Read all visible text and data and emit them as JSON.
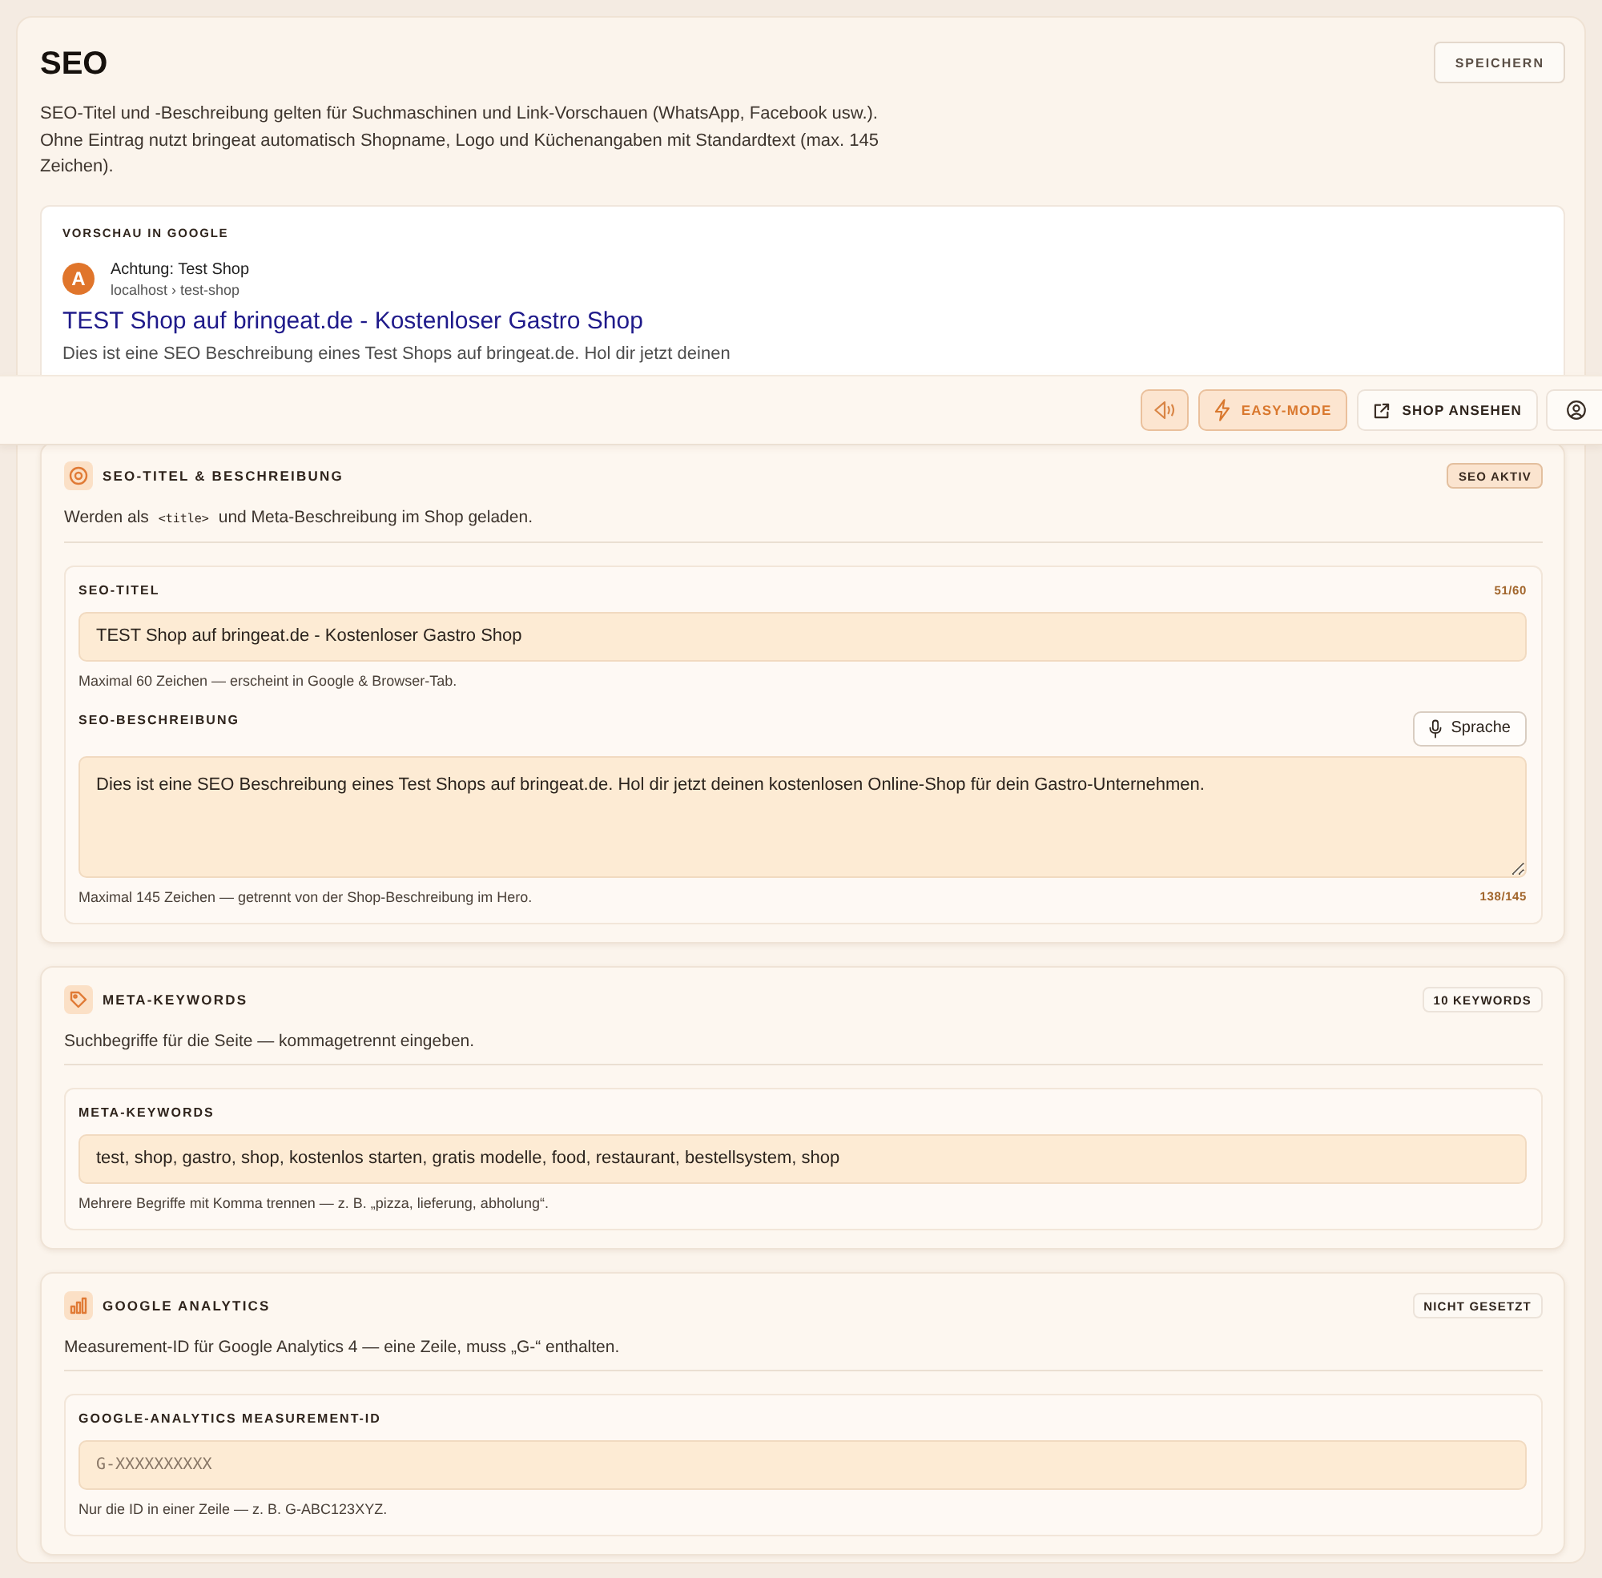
{
  "page": {
    "title": "SEO",
    "save_button": "SPEICHERN",
    "intro": "SEO-Titel und -Beschreibung gelten für Suchmaschinen und Link-Vorschauen (WhatsApp, Facebook usw.). Ohne Eintrag nutzt bringeat automatisch Shopname, Logo und Küchenangaben mit Standardtext (max. 145 Zeichen)."
  },
  "preview": {
    "heading": "VORSCHAU IN GOOGLE",
    "avatar_letter": "A",
    "site_name": "Achtung: Test Shop",
    "url": "localhost › test-shop",
    "title": "TEST Shop auf bringeat.de - Kostenloser Gastro Shop",
    "description": "Dies ist eine SEO Beschreibung eines Test Shops auf bringeat.de. Hol dir jetzt deinen"
  },
  "toolbar": {
    "sound_button": {
      "on": true
    },
    "easy_mode_button": {
      "label": "EASY-MODE",
      "on": true
    },
    "shop_button": {
      "label": "SHOP ANSEHEN"
    }
  },
  "sections": [
    {
      "kind": "seo",
      "title": "SEO-TITEL & BESCHREIBUNG",
      "badge": {
        "label": "SEO AKTIV",
        "active": true
      },
      "description": [
        {
          "kind": "text",
          "text": "Werden als "
        },
        {
          "kind": "code",
          "text": "<title>"
        },
        {
          "kind": "text",
          "text": " und Meta-Beschreibung im Shop geladen."
        }
      ],
      "fields": [
        {
          "kind": "input",
          "label": "SEO-TITEL",
          "counter": "51/60",
          "value": "TEST Shop auf bringeat.de - Kostenloser Gastro Shop",
          "hint": "Maximal 60 Zeichen — erscheint in Google & Browser-Tab."
        },
        {
          "kind": "textarea",
          "label": "SEO-BESCHREIBUNG",
          "voice_button": "Sprache",
          "value": "Dies ist eine SEO Beschreibung eines Test Shops auf bringeat.de. Hol dir jetzt deinen kostenlosen Online-Shop für dein Gastro-Unternehmen.",
          "hint": "Maximal 145 Zeichen — getrennt von der Shop-Beschreibung im Hero.",
          "counter": "138/145"
        }
      ]
    },
    {
      "kind": "keywords",
      "title": "META-KEYWORDS",
      "badge": {
        "label": "10 KEYWORDS",
        "active": false
      },
      "description": [
        {
          "kind": "text",
          "text": "Suchbegriffe für die Seite — kommagetrennt eingeben."
        }
      ],
      "fields": [
        {
          "kind": "input",
          "label": "META-KEYWORDS",
          "value": "test, shop, gastro, shop, kostenlos starten, gratis modelle, food, restaurant, bestellsystem, shop",
          "hint": "Mehrere Begriffe mit Komma trennen — z. B. „pizza, lieferung, abholung“."
        }
      ]
    },
    {
      "kind": "analytics",
      "title": "GOOGLE ANALYTICS",
      "badge": {
        "label": "NICHT GESETZT",
        "active": false
      },
      "description": [
        {
          "kind": "text",
          "text": "Measurement-ID für Google Analytics 4 — eine Zeile, muss „G-“ enthalten."
        }
      ],
      "fields": [
        {
          "kind": "input",
          "label": "GOOGLE-ANALYTICS MEASUREMENT-ID",
          "placeholder": "G-XXXXXXXXXX",
          "hint": "Nur die ID in einer Zeile — z. B. G-ABC123XYZ."
        }
      ]
    }
  ]
}
